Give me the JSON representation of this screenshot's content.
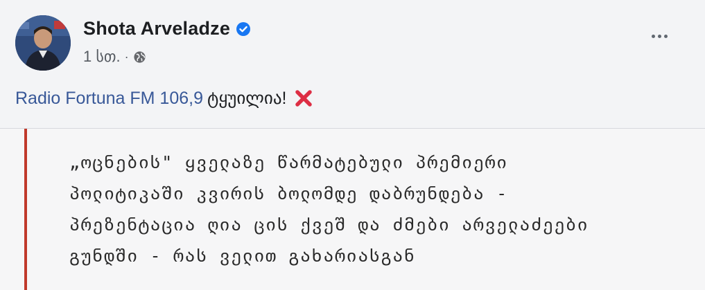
{
  "post": {
    "author": "Shota Arveladze",
    "verified": true,
    "timestamp": "1 სთ.",
    "separator": "·",
    "audience_icon": "globe-icon",
    "text": {
      "link": "Radio Fortuna FM 106,9",
      "after": "ტყუილია!",
      "emoji": "cross-mark-icon"
    },
    "more_icon": "more-options-icon"
  },
  "shared_article": {
    "accent_color": "#c0392b",
    "headline_lines": [
      "„ოცნების\" ყველაზე წარმატებული პრემიერი",
      "პოლიტიკაში კვირის ბოლომდე დაბრუნდება -",
      "პრეზენტაცია ღია ცის ქვეშ და ძმები არველაძეები",
      "გუნდში - რას ველით გახარიასგან"
    ]
  },
  "colors": {
    "link": "#385898",
    "verified": "#1877f2",
    "cross": "#dd2e44"
  }
}
